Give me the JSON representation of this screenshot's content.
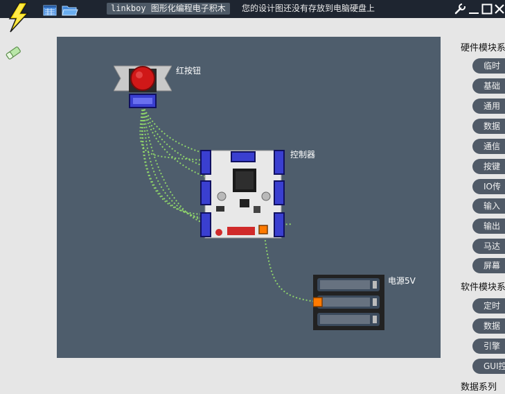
{
  "app": {
    "title": "linkboy 图形化编程电子积木",
    "save_status": "您的设计图还没有存放到电脑硬盘上"
  },
  "toolbar": {
    "icons": [
      "lightning-logo-icon",
      "new-file-icon",
      "open-folder-icon",
      "wrench-icon",
      "minimize-icon",
      "maximize-icon",
      "close-icon",
      "eraser-icon"
    ]
  },
  "canvas": {
    "modules": [
      {
        "label": "红按钮"
      },
      {
        "label": "控制器"
      },
      {
        "label": "电源5V"
      }
    ]
  },
  "panel": {
    "hardware_title": "硬件模块系",
    "hardware_items": [
      "临时",
      "基础",
      "通用",
      "数据",
      "通信",
      "按键",
      "IO传",
      "输入",
      "输出",
      "马达",
      "屏幕"
    ],
    "software_title": "软件模块系",
    "software_items": [
      "定时",
      "数据",
      "引擎",
      "GUI控"
    ],
    "data_title": "数据系列"
  },
  "colors": {
    "topbar": "#1e2530",
    "canvas": "#4e5d6c",
    "pill": "#505a67",
    "wire": "#8fd36b",
    "port_blue": "#3a3fd0",
    "button_red": "#d01818"
  }
}
